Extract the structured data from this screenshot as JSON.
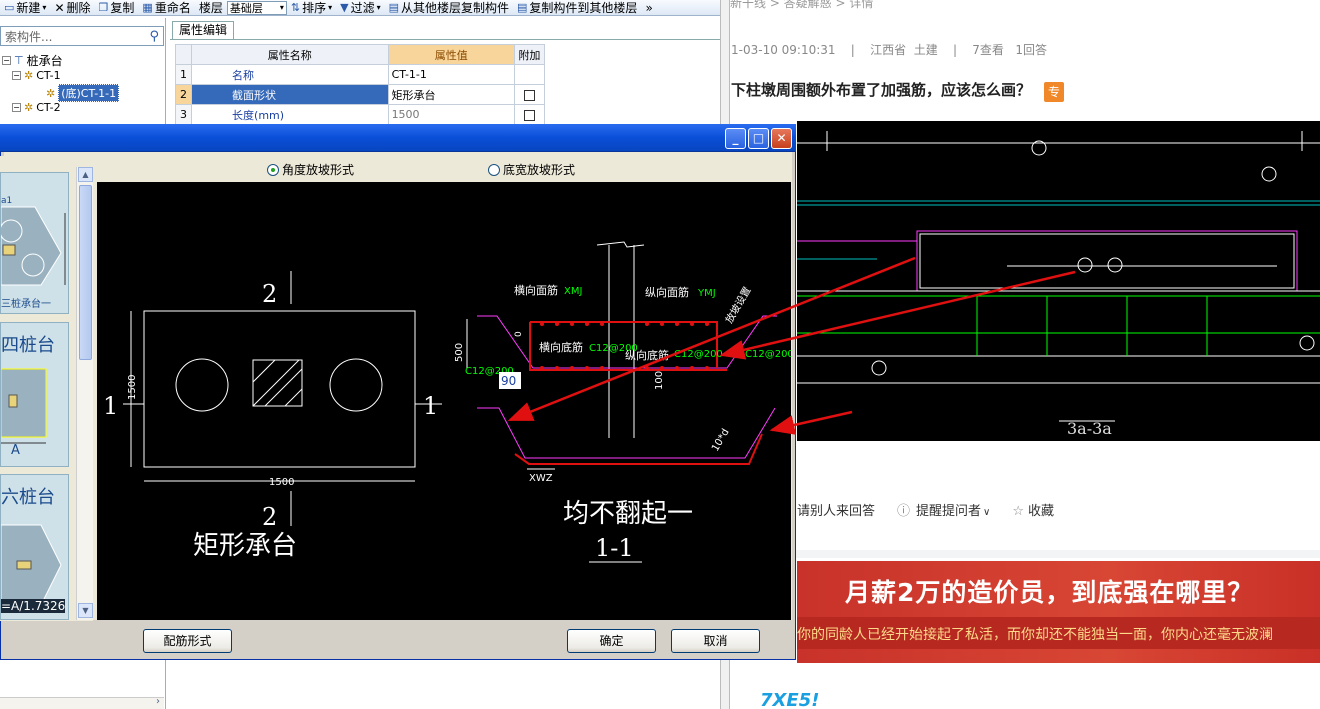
{
  "toolbar": {
    "new": "新建",
    "delete": "删除",
    "copy": "复制",
    "rename": "重命名",
    "floor_label": "楼层",
    "floor_value": "基础层",
    "sort": "排序",
    "filter": "过滤",
    "copy_from": "从其他楼层复制构件",
    "copy_to": "复制构件到其他楼层"
  },
  "tree": {
    "search_placeholder": "索构件...",
    "root": "桩承台",
    "nodes": [
      "CT-1",
      "(底)CT-1-1",
      "CT-2"
    ]
  },
  "props": {
    "tab": "属性编辑",
    "headers": [
      "属性名称",
      "属性值",
      "附加"
    ],
    "rows": [
      {
        "n": "1",
        "name": "名称",
        "value": "CT-1-1"
      },
      {
        "n": "2",
        "name": "截面形状",
        "value": "矩形承台"
      },
      {
        "n": "3",
        "name": "长度(mm)",
        "value": "1500"
      }
    ]
  },
  "web": {
    "breadcrumb": "新干线 > 答疑解惑 > 详情",
    "meta": "1-03-10 09:10:31    |    江西省  土建    |    7查看   1回答",
    "title": "下柱墩周围额外布置了加强筋，应该怎么画？",
    "badge": "专",
    "cad_caption": "3a-3a",
    "actions": [
      "请别人来回答",
      "提醒提问者",
      "收藏"
    ],
    "banner_title": "月薪2万的造价员，到底强在哪里？",
    "banner_sub": "你的同龄人已经开始接起了私活，而你却还不能独当一面，你内心还毫无波澜"
  },
  "dialog": {
    "radio_angle": "角度放坡形式",
    "radio_width": "底宽放坡形式",
    "left_title": "矩形承台",
    "right_title": "均不翻起一",
    "right_section": "1-1",
    "dim_1500": "1500",
    "sec_label_2": "2",
    "sec_label_1": "1",
    "labels": {
      "xmj": "横向面筋",
      "ymj": "纵向面筋",
      "hxdj": "横向底筋",
      "zxdj": "纵向底筋",
      "code_xmj": "XMJ",
      "code_ymj": "YMJ",
      "c12a": "C12@200",
      "c12b": "C12@200",
      "c12c": "C12@200",
      "c12d": "C12@200",
      "d500": "500",
      "d90": "90",
      "d100": "100",
      "d0": "0",
      "xwz": "XWZ",
      "d10": "10*d",
      "slope": "放坡设置"
    },
    "thumbs": [
      {
        "label": "四桩台"
      },
      {
        "label": "六桩台"
      }
    ],
    "thumb_caption": "三桩承台一",
    "thumb_formula": "=A/1.7326",
    "thumb_a": "A",
    "btn_rebar": "配筋形式",
    "btn_ok": "确定",
    "btn_cancel": "取消"
  },
  "colors": {
    "title_blue": "#0a4fd8",
    "selection": "#3569b9",
    "annotation_red": "#e01010",
    "banner_red": "#d84634"
  }
}
